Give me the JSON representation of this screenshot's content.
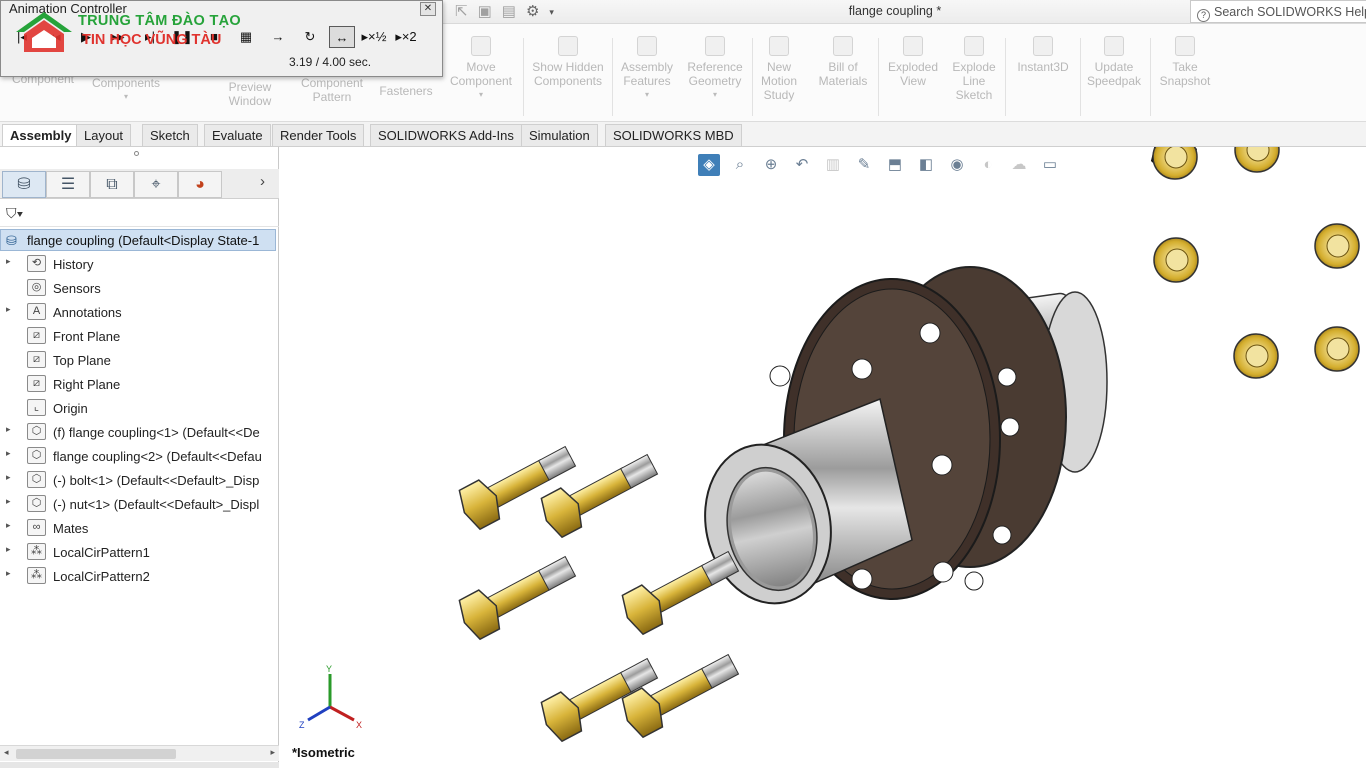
{
  "window": {
    "doc_title": "flange coupling *",
    "search_placeholder": "Search SOLIDWORKS Help"
  },
  "animation_controller": {
    "title": "Animation Controller",
    "time": "3.19 / 4.00 sec.",
    "controls": [
      "skip-to-start",
      "play",
      "loop",
      "reciprocate",
      "speed-half",
      "speed-double"
    ],
    "speed_half_label": "▸×½",
    "speed_double_label": "▸×2"
  },
  "logo": {
    "line1": "TRUNG TÂM ĐÀO TẠO",
    "line2": "TIN HỌC VŨNG TÀU"
  },
  "ribbon": {
    "buttons": [
      {
        "label": "Component",
        "disabled": true
      },
      {
        "label": "Components",
        "disabled": true
      },
      {
        "label": "Preview Window",
        "disabled": true
      },
      {
        "label": "Component Pattern",
        "disabled": true
      },
      {
        "label": "Fasteners",
        "disabled": true
      },
      {
        "label": "Move Component",
        "disabled": true
      },
      {
        "label": "Show Hidden Components",
        "disabled": true
      },
      {
        "label": "Assembly Features",
        "disabled": true
      },
      {
        "label": "Reference Geometry",
        "disabled": true
      },
      {
        "label": "New Motion Study",
        "disabled": true
      },
      {
        "label": "Bill of Materials",
        "disabled": true
      },
      {
        "label": "Exploded View",
        "disabled": true
      },
      {
        "label": "Explode Line Sketch",
        "disabled": true
      },
      {
        "label": "Instant3D",
        "disabled": true
      },
      {
        "label": "Update Speedpak",
        "disabled": true
      },
      {
        "label": "Take Snapshot",
        "disabled": true
      }
    ]
  },
  "tabs": [
    {
      "label": "Assembly",
      "active": true
    },
    {
      "label": "Layout"
    },
    {
      "label": "Sketch"
    },
    {
      "label": "Evaluate"
    },
    {
      "label": "Render Tools"
    },
    {
      "label": "SOLIDWORKS Add-Ins"
    },
    {
      "label": "Simulation"
    },
    {
      "label": "SOLIDWORKS MBD"
    }
  ],
  "feature_tree": {
    "root": "flange coupling  (Default<Display State-1",
    "items": [
      {
        "label": "History",
        "expandable": true,
        "icon": "history-icon"
      },
      {
        "label": "Sensors",
        "expandable": false,
        "icon": "sensor-icon"
      },
      {
        "label": "Annotations",
        "expandable": true,
        "icon": "annotation-icon"
      },
      {
        "label": "Front Plane",
        "expandable": false,
        "icon": "plane-icon"
      },
      {
        "label": "Top Plane",
        "expandable": false,
        "icon": "plane-icon"
      },
      {
        "label": "Right Plane",
        "expandable": false,
        "icon": "plane-icon"
      },
      {
        "label": "Origin",
        "expandable": false,
        "icon": "origin-icon"
      },
      {
        "label": "(f) flange coupling<1> (Default<<De",
        "expandable": true,
        "icon": "part-icon"
      },
      {
        "label": "flange coupling<2> (Default<<Defau",
        "expandable": true,
        "icon": "part-icon"
      },
      {
        "label": "(-) bolt<1> (Default<<Default>_Disp",
        "expandable": true,
        "icon": "part-icon"
      },
      {
        "label": "(-) nut<1> (Default<<Default>_Displ",
        "expandable": true,
        "icon": "part-icon"
      },
      {
        "label": "Mates",
        "expandable": true,
        "icon": "mates-icon"
      },
      {
        "label": "LocalCirPattern1",
        "expandable": true,
        "icon": "pattern-icon"
      },
      {
        "label": "LocalCirPattern2",
        "expandable": true,
        "icon": "pattern-icon"
      }
    ]
  },
  "viewport": {
    "view_orientation": "*Isometric",
    "triad_labels": {
      "x": "X",
      "y": "Y",
      "z": "Z"
    },
    "colors": {
      "flange_face": "#4a3b32",
      "hub_metal": "#cfcfcf",
      "bolt_brass": "#d8b43a",
      "nut_brass": "#d4ae2e"
    }
  }
}
